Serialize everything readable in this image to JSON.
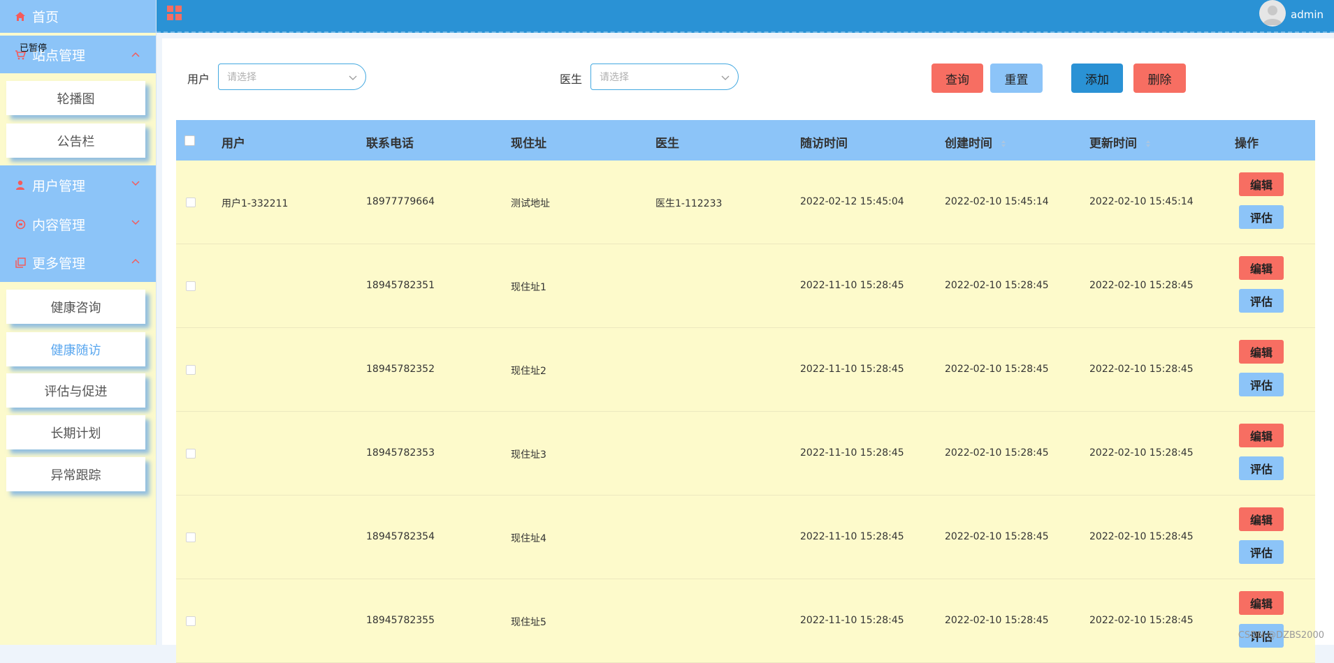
{
  "sidebar": {
    "tooltip": "已暂停",
    "home": "首页",
    "site_mgmt": "站点管理",
    "site_sub": [
      "轮播图",
      "公告栏"
    ],
    "user_mgmt": "用户管理",
    "content_mgmt": "内容管理",
    "more_mgmt": "更多管理",
    "more_sub": [
      "健康咨询",
      "健康随访",
      "评估与促进",
      "长期计划",
      "异常跟踪"
    ],
    "active_sub": "健康随访"
  },
  "header": {
    "username": "admin"
  },
  "filters": {
    "user_label": "用户",
    "user_placeholder": "请选择",
    "doctor_label": "医生",
    "doctor_placeholder": "请选择"
  },
  "buttons": {
    "query": "查询",
    "reset": "重置",
    "add": "添加",
    "delete": "删除"
  },
  "table": {
    "headers": [
      "用户",
      "联系电话",
      "现住址",
      "医生",
      "随访时间",
      "创建时间",
      "更新时间",
      "操作"
    ],
    "edit_label": "编辑",
    "eval_label": "评估",
    "rows": [
      {
        "user": "用户1-332211",
        "phone": "18977779664",
        "address": "测试地址",
        "doctor": "医生1-112233",
        "visit": "2022-02-12 15:45:04",
        "created": "2022-02-10 15:45:14",
        "updated": "2022-02-10 15:45:14"
      },
      {
        "user": "",
        "phone": "18945782351",
        "address": "现住址1",
        "doctor": "",
        "visit": "2022-11-10 15:28:45",
        "created": "2022-02-10 15:28:45",
        "updated": "2022-02-10 15:28:45"
      },
      {
        "user": "",
        "phone": "18945782352",
        "address": "现住址2",
        "doctor": "",
        "visit": "2022-11-10 15:28:45",
        "created": "2022-02-10 15:28:45",
        "updated": "2022-02-10 15:28:45"
      },
      {
        "user": "",
        "phone": "18945782353",
        "address": "现住址3",
        "doctor": "",
        "visit": "2022-11-10 15:28:45",
        "created": "2022-02-10 15:28:45",
        "updated": "2022-02-10 15:28:45"
      },
      {
        "user": "",
        "phone": "18945782354",
        "address": "现住址4",
        "doctor": "",
        "visit": "2022-11-10 15:28:45",
        "created": "2022-02-10 15:28:45",
        "updated": "2022-02-10 15:28:45"
      },
      {
        "user": "",
        "phone": "18945782355",
        "address": "现住址5",
        "doctor": "",
        "visit": "2022-11-10 15:28:45",
        "created": "2022-02-10 15:28:45",
        "updated": "2022-02-10 15:28:45"
      }
    ]
  },
  "watermark": "CSDN @DZBS2000",
  "colors": {
    "header_bg": "#2a92d5",
    "menu_bg": "#8cc4f8",
    "sidebar_bg": "#fcfacc",
    "row_bg": "#fdfacb",
    "danger": "#f76e62",
    "accent": "#5aa7ef"
  }
}
